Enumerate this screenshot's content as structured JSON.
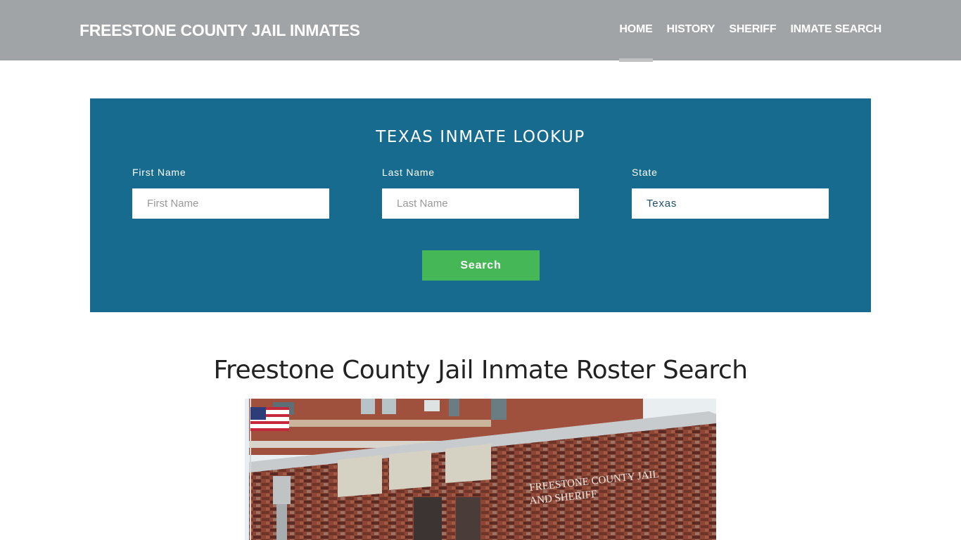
{
  "header": {
    "brand": "FREESTONE COUNTY JAIL INMATES",
    "nav": [
      {
        "label": "HOME",
        "active": true
      },
      {
        "label": "HISTORY",
        "active": false
      },
      {
        "label": "SHERIFF",
        "active": false
      },
      {
        "label": "INMATE SEARCH",
        "active": false
      }
    ]
  },
  "lookup": {
    "title": "TEXAS INMATE LOOKUP",
    "first_name": {
      "label": "First Name",
      "placeholder": "First Name",
      "value": ""
    },
    "last_name": {
      "label": "Last Name",
      "placeholder": "Last Name",
      "value": ""
    },
    "state": {
      "label": "State",
      "selected": "Texas"
    },
    "search_label": "Search",
    "colors": {
      "panel": "#176b8e",
      "button": "#45b757"
    }
  },
  "main": {
    "title": "Freestone County Jail Inmate Roster Search",
    "image_alt": "Freestone County Jail and Sheriff building",
    "building_sign_line1": "FREESTONE COUNTY JAIL",
    "building_sign_line2": "AND SHERIFF"
  }
}
